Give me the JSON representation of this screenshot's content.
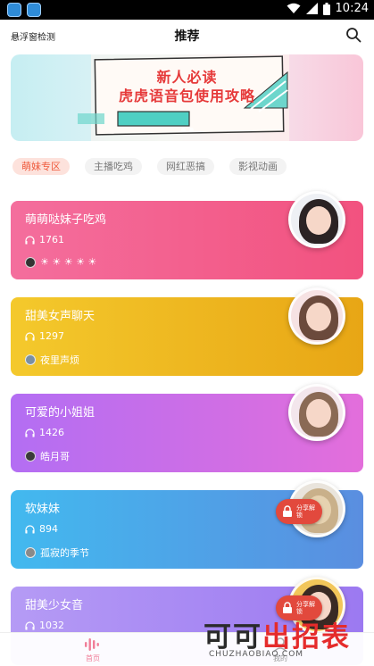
{
  "status_bar": {
    "time": "10:24",
    "icons": [
      "app-icon",
      "app-icon",
      "wifi-icon",
      "signal-icon",
      "battery-icon"
    ]
  },
  "header": {
    "left_text": "悬浮窗检测",
    "title": "推荐"
  },
  "banner": {
    "line1": "新人必读",
    "line2": "虎虎语音包使用攻略"
  },
  "tags": [
    "萌妹专区",
    "主播吃鸡",
    "网红恶搞",
    "影视动画"
  ],
  "active_tag_index": 0,
  "cards": [
    {
      "title": "萌萌哒妹子吃鸡",
      "plays": "1761",
      "author": "☀ ☀ ☀ ☀ ☀",
      "gradient": [
        "#f46e9d",
        "#f2527f"
      ],
      "locked": false,
      "badge": ""
    },
    {
      "title": "甜美女声聊天",
      "plays": "1297",
      "author": "夜里声烦",
      "gradient": [
        "#f4c92c",
        "#e8a615"
      ],
      "locked": false,
      "badge": ""
    },
    {
      "title": "可爱的小姐姐",
      "plays": "1426",
      "author": "皓月哥",
      "gradient": [
        "#b36ef3",
        "#e36edb"
      ],
      "locked": false,
      "badge": ""
    },
    {
      "title": "软妹妹",
      "plays": "894",
      "author": "孤寂的季节",
      "gradient": [
        "#42b9ef",
        "#5a8ee0"
      ],
      "locked": true,
      "badge": "分享解锁"
    },
    {
      "title": "甜美少女音",
      "plays": "1032",
      "author": "",
      "gradient": [
        "#b59bf5",
        "#9c79f1"
      ],
      "locked": true,
      "badge": "分享解锁"
    }
  ],
  "bottom_nav": {
    "home": "首页",
    "mine": "我的"
  },
  "watermark": {
    "text_dark": "可可",
    "text_red": "出招表",
    "url": "CHUZHAOBIAO.COM"
  },
  "colors": {
    "accent": "#ef5a3c",
    "nav_active": "#f07e98"
  }
}
